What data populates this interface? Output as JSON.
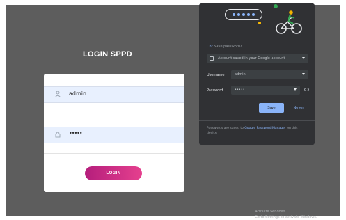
{
  "login": {
    "title": "LOGIN SPPD",
    "username_value": "admin",
    "password_value": "•••••",
    "button_label": "LOGIN"
  },
  "password_popup": {
    "title_prefix": "Chr",
    "title_rest": "Save password?",
    "account_text": "Account saved in your Google account",
    "username_label": "Username",
    "username_value": "admin",
    "password_label": "Password",
    "password_value": "•••••",
    "save_label": "Save",
    "never_label": "Never",
    "footer_prefix": "Passwords are saved to",
    "footer_link": "Google Password Manager",
    "footer_suffix": "on this device"
  },
  "watermark": {
    "line1": "Activate Windows",
    "line2": "Go to Settings to activate Windows."
  },
  "icons": {
    "user": "user-icon",
    "password": "lock-icon",
    "account": "account-icon",
    "eye": "eye-icon"
  },
  "colors": {
    "screen_bg": "#5d5d5d",
    "login_gradient_start": "#b51e7c",
    "login_gradient_end": "#e5408e",
    "popup_bg": "#303134",
    "accent": "#8ab4f8"
  }
}
